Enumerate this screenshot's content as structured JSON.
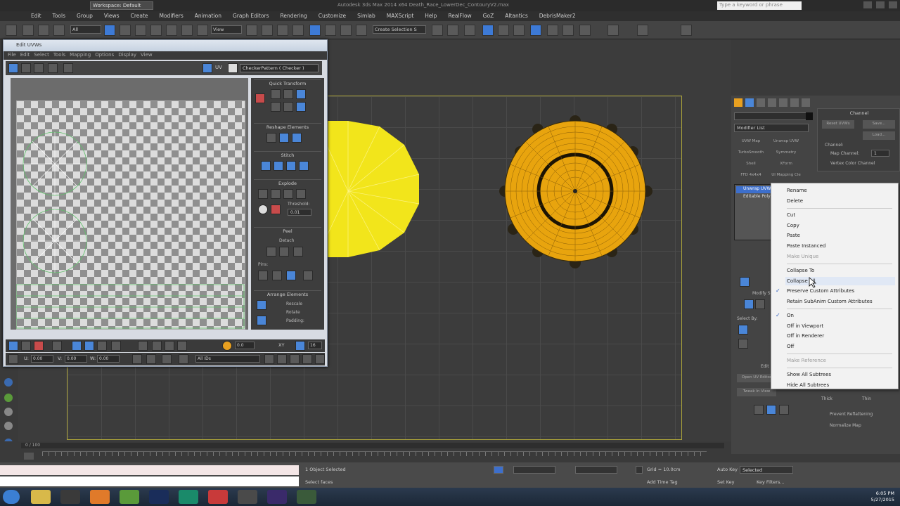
{
  "app": {
    "title": "Autodesk 3ds Max  2014 x64     Death_Race_LowerDec_ContouryV2.max",
    "workspace": "Workspace: Default",
    "search_placeholder": "Type a keyword or phrase"
  },
  "menubar": [
    "Edit",
    "Tools",
    "Group",
    "Views",
    "Create",
    "Modifiers",
    "Animation",
    "Graph Editors",
    "Rendering",
    "Customize",
    "Simlab",
    "MAXScript",
    "Help",
    "RealFlow",
    "GoZ",
    "Altantics",
    "DebrisMaker2"
  ],
  "toolbar": {
    "filter": "All",
    "refcoord": "View",
    "selection_set": "Create Selection S"
  },
  "unwrap": {
    "title": "Edit UVWs",
    "menu": [
      "File",
      "Edit",
      "Select",
      "Tools",
      "Mapping",
      "Options",
      "Display",
      "View"
    ],
    "uv_label": "UV",
    "checker": "CheckerPattern ( Checker )",
    "rollouts": [
      "Quick Transform",
      "Reshape Elements",
      "Stitch",
      "Explode",
      "Peel",
      "Arrange Elements"
    ],
    "weld_threshold_label": "Threshold:",
    "weld_threshold": "0.01",
    "detach_label": "Detach",
    "pins_label": "Pins:",
    "rescale_label": "Rescale",
    "rotate_label": "Rotate",
    "padding_label": "Padding:",
    "bottom": {
      "u_label": "U:",
      "u_value": "0.00",
      "v_label": "V:",
      "v_value": "0.00",
      "w_label": "W:",
      "w_value": "0.00",
      "xy_label": "XY",
      "zoom_value": "0.0",
      "ids_value": "All IDs",
      "spin_value": "16"
    }
  },
  "cmdpanel": {
    "modifier_list": "Modifier List",
    "buttons": [
      "UVW Map",
      "Unwrap UVW",
      "TurboSmooth",
      "Symmetry",
      "Shell",
      "XForm",
      "FFD 4x4x4",
      "UI Mapping Cle"
    ],
    "stack": [
      "Unwrap UVW",
      "Editable Poly"
    ],
    "channel_title": "Channel",
    "reset_uvws": "Reset UVWs",
    "save": "Save...",
    "load": "Load...",
    "channel_label": "Channel:",
    "map_channel": "Map Channel:",
    "map_channel_value": "1",
    "vertex_color_channel": "Vertex Color Channel",
    "select_label": "Select By:",
    "modify_selection": "Modify Selection",
    "edit_label": "Edit",
    "open_uv_editor": "Open UV Editor",
    "tweak_in_view": "Tweak In View",
    "thick": "Thick",
    "thin": "Thin",
    "prevent_reflattening": "Prevent Reflattening",
    "normalize_map": "Normalize Map"
  },
  "context_menu": {
    "items": [
      {
        "label": "Rename",
        "state": "normal"
      },
      {
        "label": "Delete",
        "state": "normal"
      },
      {
        "label": "Cut",
        "state": "normal"
      },
      {
        "label": "Copy",
        "state": "normal"
      },
      {
        "label": "Paste",
        "state": "normal"
      },
      {
        "label": "Paste Instanced",
        "state": "normal"
      },
      {
        "label": "Make Unique",
        "state": "disabled"
      },
      {
        "label": "Collapse To",
        "state": "normal"
      },
      {
        "label": "Collapse All",
        "state": "hover"
      },
      {
        "label": "Preserve Custom Attributes",
        "state": "checked"
      },
      {
        "label": "Retain SubAnim Custom Attributes",
        "state": "normal"
      },
      {
        "label": "On",
        "state": "checked"
      },
      {
        "label": "Off in Viewport",
        "state": "normal"
      },
      {
        "label": "Off in Renderer",
        "state": "normal"
      },
      {
        "label": "Off",
        "state": "normal"
      },
      {
        "label": "Make Reference",
        "state": "disabled"
      },
      {
        "label": "Show All Subtrees",
        "state": "normal"
      },
      {
        "label": "Hide All Subtrees",
        "state": "normal"
      }
    ]
  },
  "timeline": {
    "frame": "0 / 100",
    "ticks": [
      "0",
      "5",
      "10",
      "15",
      "20",
      "25",
      "30",
      "35",
      "40",
      "45",
      "50",
      "55",
      "60",
      "65",
      "70",
      "75",
      "80",
      "85",
      "90",
      "95",
      "100"
    ]
  },
  "status": {
    "selected": "1 Object Selected",
    "prompt": "Select faces",
    "grid": "Grid = 10.0cm",
    "add_time_tag": "Add Time Tag",
    "auto_key": "Auto Key",
    "set_key": "Set Key",
    "selected_dropdown": "Selected",
    "key_filters": "Key Filters..."
  },
  "taskbar": {
    "time": "6:05 PM",
    "date": "5/27/2015"
  },
  "colors": {
    "yellow_disc": "#f2e51b",
    "wheel_orange": "#e8a40e",
    "grid_boundary": "#aaa23a",
    "uv_seam": "#5fc06a"
  }
}
